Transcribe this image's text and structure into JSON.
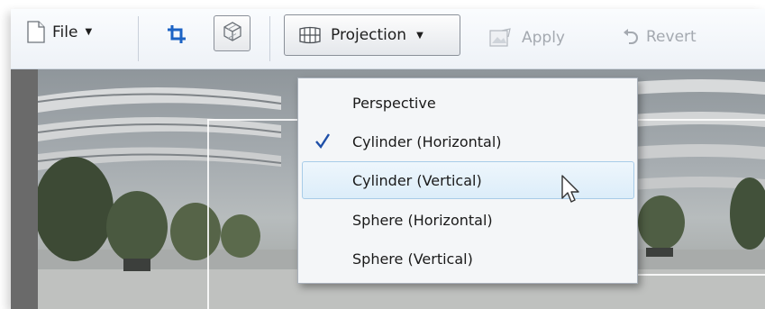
{
  "toolbar": {
    "file_label": "File",
    "projection_label": "Projection",
    "apply_label": "Apply",
    "revert_label": "Revert",
    "icons": {
      "file": "document-icon",
      "crop": "crop-icon",
      "perspective": "cube-icon",
      "projection": "grid-projection-icon",
      "apply": "apply-image-icon",
      "revert": "undo-arrow-icon"
    }
  },
  "projection_menu": {
    "items": [
      {
        "label": "Perspective",
        "checked": false,
        "hovered": false
      },
      {
        "label": "Cylinder (Horizontal)",
        "checked": true,
        "hovered": false
      },
      {
        "label": "Cylinder (Vertical)",
        "checked": false,
        "hovered": true
      },
      {
        "label": "Sphere (Horizontal)",
        "checked": false,
        "hovered": false
      },
      {
        "label": "Sphere (Vertical)",
        "checked": false,
        "hovered": false
      }
    ]
  },
  "colors": {
    "accent": "#1e4fa8",
    "crop_icon": "#1c63c4",
    "hover_fill": "#dcedf9",
    "hover_border": "#a8cce8",
    "disabled_text": "#a4a9b0"
  }
}
